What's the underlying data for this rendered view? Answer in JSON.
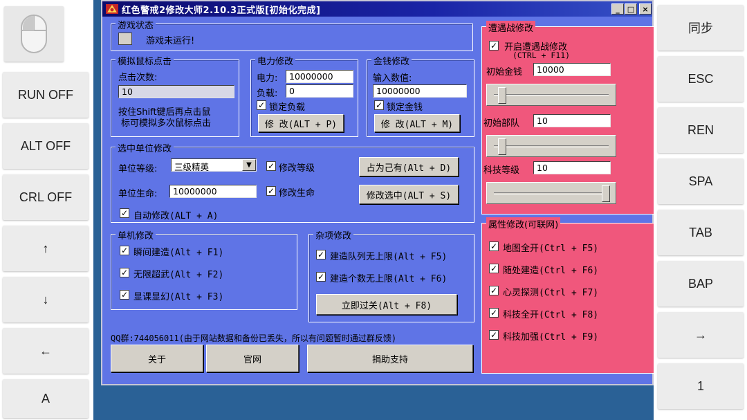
{
  "left_keys": {
    "mouse_icon": "mouse-icon",
    "run": "RUN OFF",
    "alt": "ALT OFF",
    "crl": "CRL OFF",
    "up": "↑",
    "down": "↓",
    "left": "←",
    "a": "A"
  },
  "right_keys": {
    "sync": "同步",
    "esc": "ESC",
    "ren": "REN",
    "spa": "SPA",
    "tab": "TAB",
    "bap": "BAP",
    "right": "→",
    "one": "1"
  },
  "window": {
    "title": "红色警戒2修改大师2.10.3正式版[初始化完成]",
    "minimize": "_",
    "maximize": "□",
    "close": "×"
  },
  "game_status": {
    "label": "游戏状态",
    "status_text": "游戏未运行!"
  },
  "mouse_click": {
    "label": "模拟鼠标点击",
    "count_label": "点击次数:",
    "count_value": "10",
    "hint_line1": "按住Shift键后再点击鼠",
    "hint_line2": "标可模拟多次鼠标点击"
  },
  "power": {
    "label": "电力修改",
    "power_label": "电力:",
    "power_value": "10000000",
    "load_label": "负载:",
    "load_value": "0",
    "lock_label": "锁定负载",
    "lock_checked": true,
    "modify_button": "修 改(ALT + P)"
  },
  "money": {
    "label": "金钱修改",
    "input_label": "输入数值:",
    "input_value": "10000000",
    "lock_label": "锁定金钱",
    "lock_checked": true,
    "modify_button": "修 改(ALT + M)"
  },
  "unit": {
    "label": "选中单位修改",
    "level_label": "单位等级:",
    "level_value": "三级精英",
    "modify_level_label": "修改等级",
    "modify_level_checked": true,
    "hp_label": "单位生命:",
    "hp_value": "10000000",
    "modify_hp_label": "修改生命",
    "modify_hp_checked": true,
    "auto_label": "自动修改(ALT + A)",
    "auto_checked": true,
    "capture_button": "占为己有(Alt + D)",
    "modify_selected_button": "修改选中(ALT + S)"
  },
  "single": {
    "label": "单机修改",
    "items": [
      {
        "label": "瞬间建造(Alt + F1)",
        "checked": true
      },
      {
        "label": "无限超武(Alt + F2)",
        "checked": true
      },
      {
        "label": "显课显幻(Alt + F3)",
        "checked": true
      }
    ]
  },
  "misc": {
    "label": "杂项修改",
    "items": [
      {
        "label": "建造队列无上限(Alt + F5)",
        "checked": true
      },
      {
        "label": "建造个数无上限(Alt + F6)",
        "checked": true
      }
    ],
    "win_button": "立即过关(Alt + F8)"
  },
  "footer": {
    "notice": "QQ群:744056011(由于网站数据和备份已丢失，所以有问题暂时通过群反馈)",
    "about_button": "关于",
    "website_button": "官网",
    "donate_button": "捐助支持"
  },
  "encounter": {
    "label": "遭遇战修改",
    "enable_label": "开启遭遇战修改",
    "enable_checked": true,
    "enable_hotkey": "(CTRL + F11)",
    "money_label": "初始金钱",
    "money_value": "10000",
    "money_slider": 0.05,
    "units_label": "初始部队",
    "units_value": "10",
    "units_slider": 0.05,
    "tech_label": "科技等级",
    "tech_value": "10",
    "tech_slider": 1.0
  },
  "attributes": {
    "label": "属性修改(可联网)",
    "items": [
      {
        "label": "地图全开(Ctrl + F5)",
        "checked": true
      },
      {
        "label": "随处建造(Ctrl + F6)",
        "checked": true
      },
      {
        "label": "心灵探测(Ctrl + F7)",
        "checked": true
      },
      {
        "label": "科技全开(Ctrl + F8)",
        "checked": true
      },
      {
        "label": "科技加强(Ctrl + F9)",
        "checked": true
      }
    ]
  },
  "colors": {
    "window_bg": "#5f74e6",
    "pink_panel": "#f0577c",
    "desktop": "#2a6196"
  }
}
